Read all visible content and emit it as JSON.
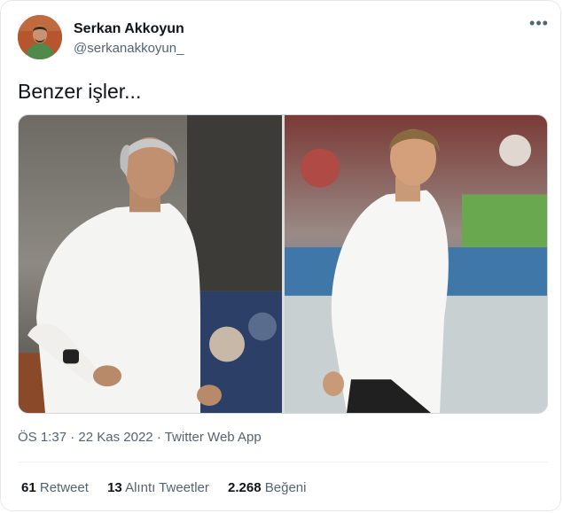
{
  "author": {
    "display_name": "Serkan Akkoyun",
    "handle": "@serkanakkoyun_"
  },
  "menu": {
    "more_label": "•••"
  },
  "tweet": {
    "text": "Benzer işler...",
    "time": "ÖS 1:37",
    "separator": "·",
    "date": "22 Kas 2022",
    "source": "Twitter Web App"
  },
  "stats": {
    "retweets_count": "61",
    "retweets_label": "Retweet",
    "quotes_count": "13",
    "quotes_label": "Alıntı Tweetler",
    "likes_count": "2.268",
    "likes_label": "Beğeni"
  }
}
